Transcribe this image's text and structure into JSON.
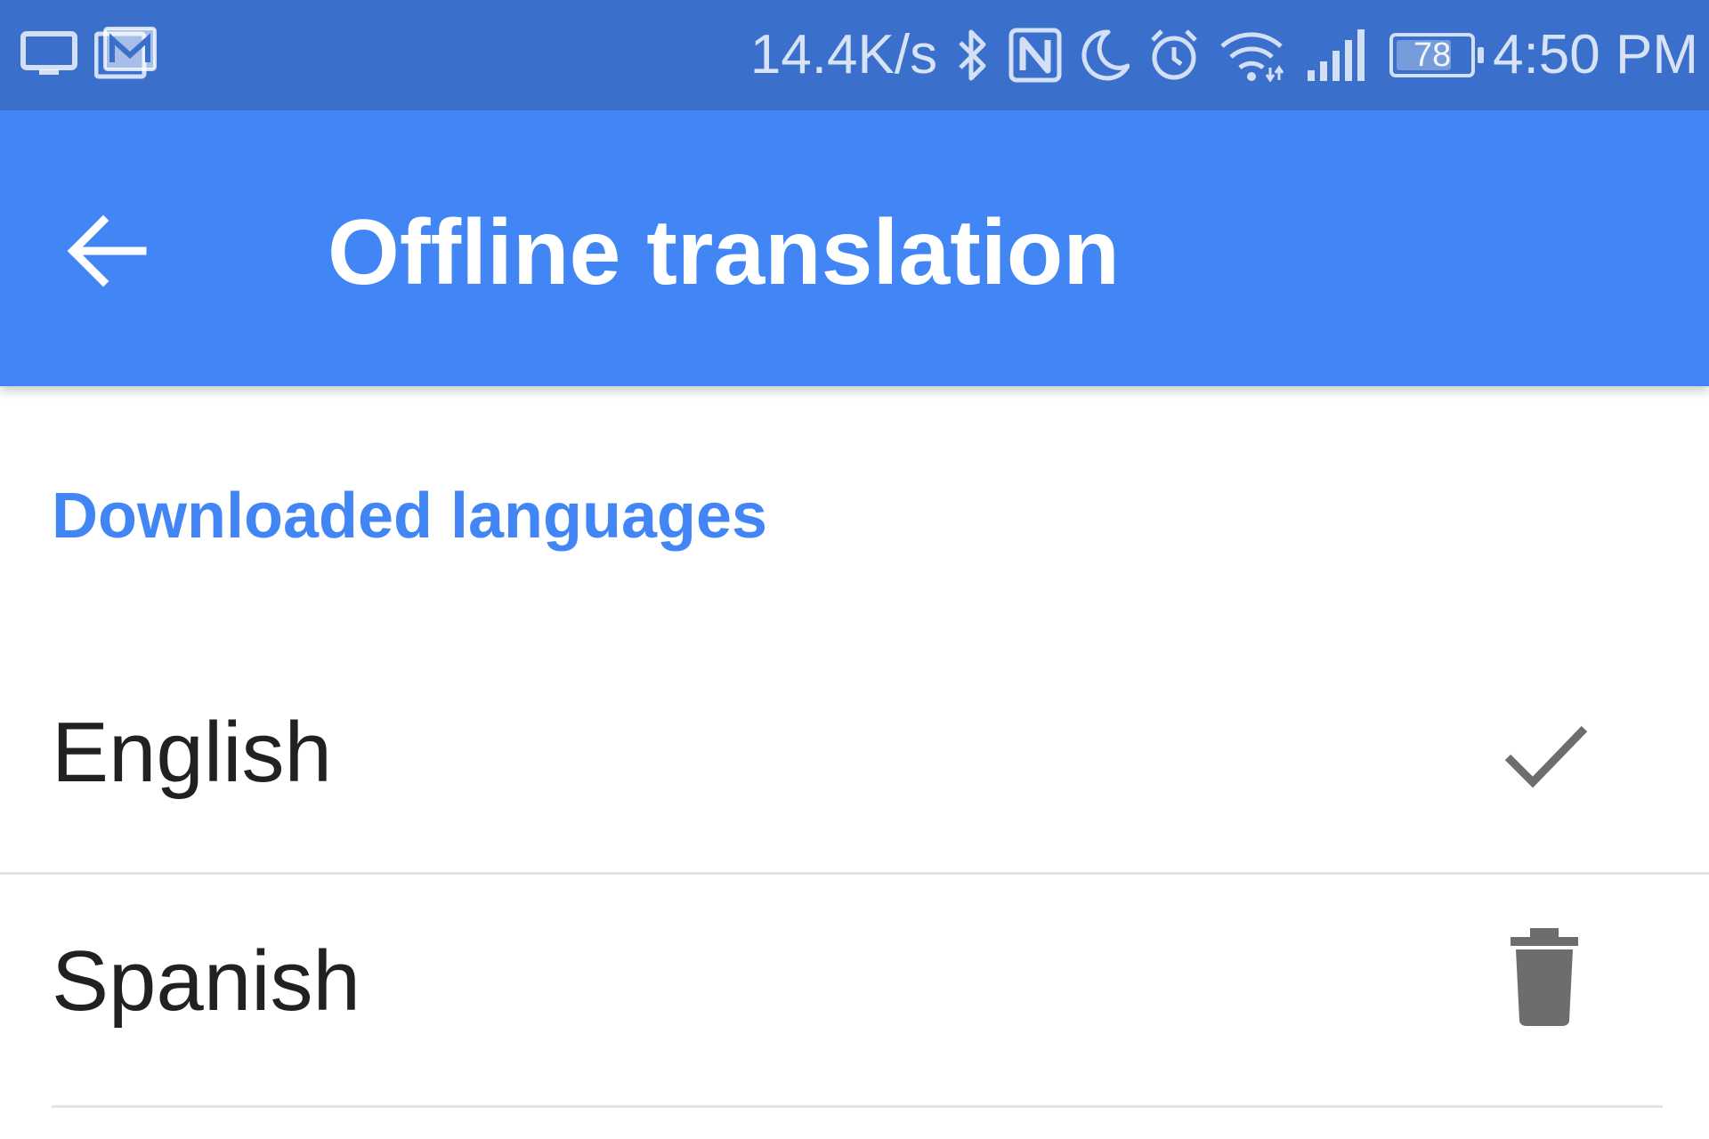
{
  "status_bar": {
    "net_speed": "14.4K/s",
    "battery_level": "78",
    "battery_fraction": 0.78,
    "time": "4:50 PM",
    "icons": [
      "screen-cast-icon",
      "mail-icon",
      "bluetooth-icon",
      "nfc-icon",
      "moon-icon",
      "alarm-icon",
      "wifi-icon",
      "signal-icon",
      "battery-icon"
    ],
    "background_color": "#3a70cc"
  },
  "app_bar": {
    "title": "Offline translation",
    "back_icon": "arrow-back-icon",
    "background_color": "#4285f4"
  },
  "section": {
    "header": "Downloaded languages",
    "accent_color": "#4285f4"
  },
  "languages": [
    {
      "label": "English",
      "action_icon": "check-icon"
    },
    {
      "label": "Spanish",
      "action_icon": "trash-icon"
    }
  ]
}
